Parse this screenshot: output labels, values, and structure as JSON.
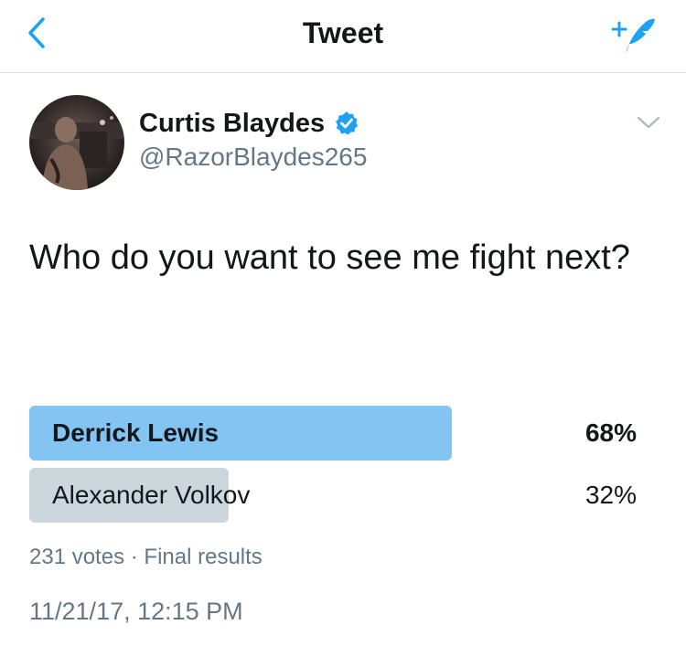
{
  "nav": {
    "title": "Tweet",
    "back_icon": "chevron-left-icon",
    "compose_icon": "compose-tweet-icon",
    "accent": "#1da1f2"
  },
  "tweet": {
    "author_name": "Curtis Blaydes",
    "handle": "@RazorBlaydes265",
    "verified": true,
    "text": "Who do you want to see me fight next?",
    "poll": {
      "options": [
        {
          "label": "Derrick Lewis",
          "percent_text": "68%",
          "percent": 68,
          "winner": true,
          "color": "#83c4f2"
        },
        {
          "label": "Alexander Volkov",
          "percent_text": "32%",
          "percent": 32,
          "winner": false,
          "color": "#ccd6dd"
        }
      ],
      "votes": "231 votes",
      "separator": "·",
      "status": "Final results"
    },
    "timestamp": "11/21/17, 12:15 PM"
  }
}
